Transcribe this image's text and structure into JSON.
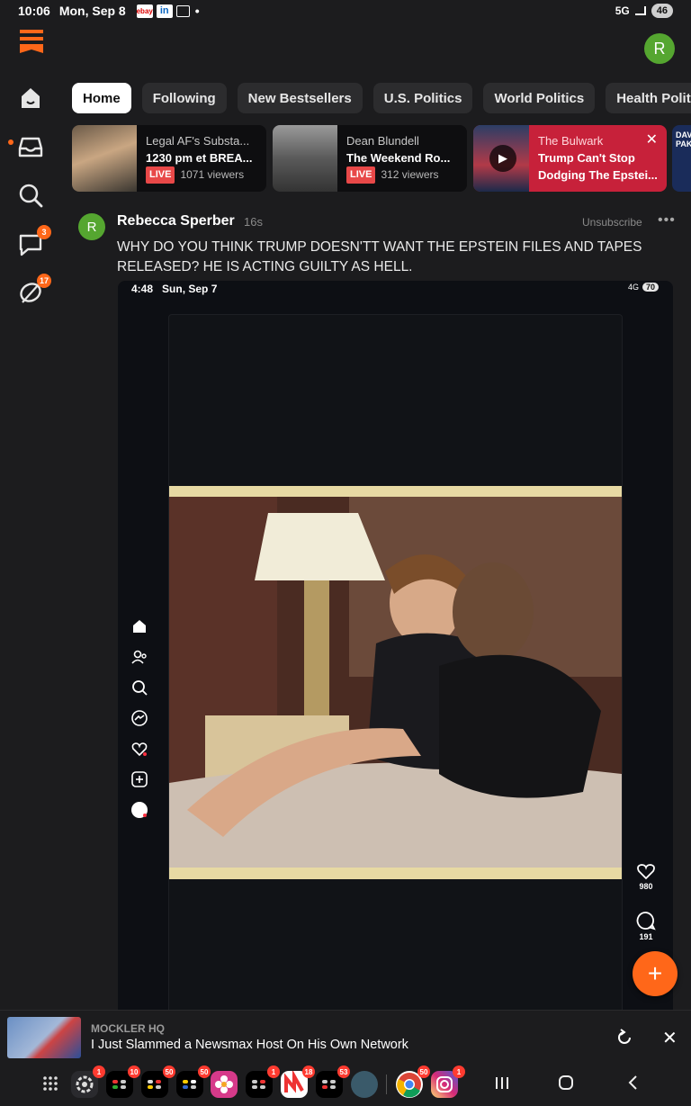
{
  "status_bar": {
    "time": "10:06",
    "date": "Mon, Sep 8",
    "icons": [
      "ebay-icon",
      "linkedin-icon",
      "screenshot-icon"
    ],
    "ebay_label": "ebay",
    "linkedin_label": "in",
    "network": "5G",
    "battery": "46"
  },
  "header": {
    "user_initial": "R",
    "brand_color": "#ff6719"
  },
  "rail": {
    "items": [
      {
        "name": "home",
        "icon": "home-icon"
      },
      {
        "name": "inbox",
        "icon": "inbox-icon",
        "unread_dot": true
      },
      {
        "name": "search",
        "icon": "search-icon"
      },
      {
        "name": "chat",
        "icon": "chat-icon",
        "badge": "3"
      },
      {
        "name": "activity",
        "icon": "activity-icon",
        "badge": "17"
      }
    ]
  },
  "tabs": [
    {
      "label": "Home",
      "active": true
    },
    {
      "label": "Following"
    },
    {
      "label": "New Bestsellers"
    },
    {
      "label": "U.S. Politics"
    },
    {
      "label": "World Politics"
    },
    {
      "label": "Health Politic"
    }
  ],
  "lives": [
    {
      "host": "Legal AF's Substa...",
      "title": "1230 pm et BREA...",
      "live": "LIVE",
      "viewers": "1071 viewers"
    },
    {
      "host": "Dean Blundell",
      "title": "The Weekend Ro...",
      "live": "LIVE",
      "viewers": "312 viewers"
    },
    {
      "host": "The Bulwark",
      "title_line1": "Trump Can't Stop",
      "title_line2": "Dodging The Epstei...",
      "close": "✕"
    }
  ],
  "fifth_card_text": "DAVID\nPAK",
  "post": {
    "author": "Rebecca Sperber",
    "time": "16s",
    "user_initial": "R",
    "unsubscribe": "Unsubscribe",
    "more": "•••",
    "text": "WHY DO YOU THINK TRUMP DOESN'TT WANT THE EPSTEIN FILES AND TAPES RELEASED? HE IS ACTING GUILTY AS HELL."
  },
  "embed": {
    "time": "4:48",
    "date": "Sun, Sep 7",
    "network": "4G",
    "battery": "70",
    "likes": "980",
    "comments": "191"
  },
  "fab": {
    "label": "+"
  },
  "mini_player": {
    "publication": "MOCKLER HQ",
    "title": "I Just Slammed a Newsmax Host On His Own Network",
    "close": "✕"
  },
  "dock": {
    "badges": [
      "1",
      "10",
      "50",
      "50",
      "1",
      "18",
      "53",
      "50",
      "1"
    ]
  }
}
